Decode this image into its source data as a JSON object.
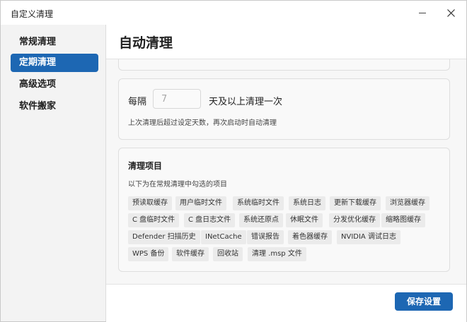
{
  "window": {
    "title": "自定义清理"
  },
  "sidebar": {
    "items": [
      {
        "label": "常规清理"
      },
      {
        "label": "定期清理"
      },
      {
        "label": "高级选项"
      },
      {
        "label": "软件搬家"
      }
    ]
  },
  "header": {
    "title": "自动清理"
  },
  "schedule": {
    "prefix": "每隔",
    "days_value": "7",
    "suffix": "天及以上清理一次",
    "hint": "上次清理后超过设定天数，再次启动时自动清理"
  },
  "items_section": {
    "title": "清理项目",
    "description": "以下为在常规清理中勾选的项目",
    "tags": [
      "预读取缓存",
      "用户临时文件",
      "系统临时文件",
      "系统日志",
      "更新下载缓存",
      "浏览器缓存",
      "C 盘临时文件",
      "C 盘日志文件",
      "系统还原点",
      "休眠文件",
      "分发优化缓存",
      "缩略图缓存",
      "Defender 扫描历史",
      "INetCache",
      "错误报告",
      "着色器缓存",
      "NVIDIA 调试日志",
      "WPS 备份",
      "软件缓存",
      "回收站",
      "清理 .msp 文件"
    ]
  },
  "footer": {
    "save_label": "保存设置"
  },
  "colors": {
    "accent": "#1d67b3"
  }
}
